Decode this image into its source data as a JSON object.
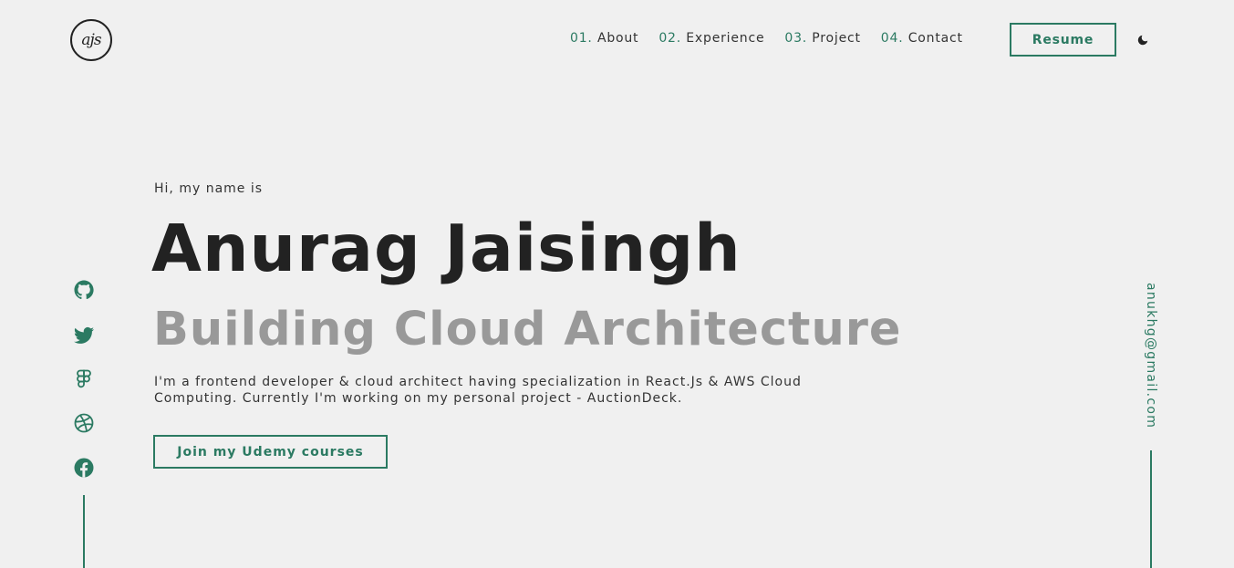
{
  "brand": {
    "logo_text": "ajs"
  },
  "nav": {
    "items": [
      {
        "num": "01.",
        "label": "About"
      },
      {
        "num": "02.",
        "label": "Experience"
      },
      {
        "num": "03.",
        "label": "Project"
      },
      {
        "num": "04.",
        "label": "Contact"
      }
    ],
    "resume_label": "Resume",
    "theme_icon": "moon-icon"
  },
  "hero": {
    "greeting": "Hi, my name is",
    "name": "Anurag Jaisingh",
    "tagline": "Building Cloud Architecture",
    "bio": "I'm a frontend developer & cloud architect having specialization in React.Js & AWS Cloud Computing. Currently I'm working on my personal project - AuctionDeck.",
    "cta_label": "Join my Udemy courses"
  },
  "socials": [
    "github-icon",
    "twitter-icon",
    "figma-icon",
    "dribbble-icon",
    "facebook-icon"
  ],
  "email": "anukhg@gmail.com",
  "colors": {
    "background": "#f0f0f0",
    "accent": "#2b7a62",
    "heading": "#222222",
    "muted": "#999999"
  }
}
